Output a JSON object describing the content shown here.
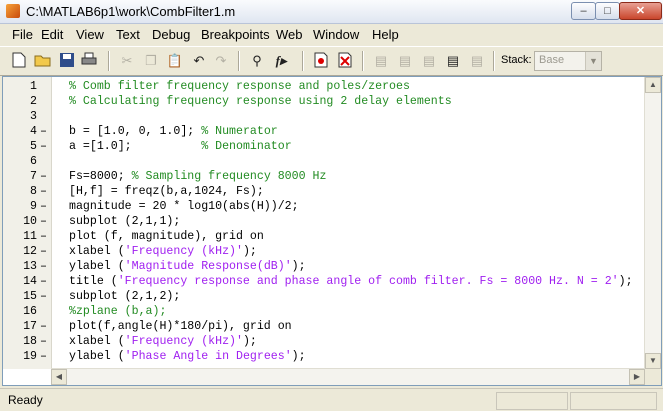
{
  "window": {
    "title": "C:\\MATLAB6p1\\work\\CombFilter1.m"
  },
  "titlebar_buttons": {
    "minimize": "–",
    "maximize": "□",
    "close": "✕"
  },
  "menu": [
    "File",
    "Edit",
    "View",
    "Text",
    "Debug",
    "Breakpoints",
    "Web",
    "Window",
    "Help"
  ],
  "toolbar": {
    "icons": [
      "new-file",
      "open-folder",
      "save",
      "print",
      "cut",
      "copy",
      "paste",
      "undo",
      "redo",
      "find",
      "function",
      "set-breakpoint",
      "clear-breakpoint",
      "step",
      "step-in",
      "step-out",
      "continue",
      "quit-debug"
    ],
    "stack_label": "Stack:",
    "stack_value": "Base"
  },
  "editor": {
    "lines": [
      {
        "n": "1",
        "bp": "",
        "segs": [
          {
            "t": "% Comb filter frequency response and poles/zeroes",
            "c": "comment"
          }
        ]
      },
      {
        "n": "2",
        "bp": "",
        "segs": [
          {
            "t": "% Calculating frequency response using 2 delay elements",
            "c": "comment"
          }
        ]
      },
      {
        "n": "3",
        "bp": "",
        "segs": []
      },
      {
        "n": "4",
        "bp": "–",
        "segs": [
          {
            "t": "b = [1.0, 0, 1.0]; ",
            "c": "plain"
          },
          {
            "t": "% Numerator",
            "c": "comment"
          }
        ]
      },
      {
        "n": "5",
        "bp": "–",
        "segs": [
          {
            "t": "a =[1.0];          ",
            "c": "plain"
          },
          {
            "t": "% Denominator",
            "c": "comment"
          }
        ]
      },
      {
        "n": "6",
        "bp": "",
        "segs": []
      },
      {
        "n": "7",
        "bp": "–",
        "segs": [
          {
            "t": "Fs=8000; ",
            "c": "plain"
          },
          {
            "t": "% Sampling frequency 8000 Hz",
            "c": "comment"
          }
        ]
      },
      {
        "n": "8",
        "bp": "–",
        "segs": [
          {
            "t": "[H,f] = freqz(b,a,1024, Fs);",
            "c": "plain"
          }
        ]
      },
      {
        "n": "9",
        "bp": "–",
        "segs": [
          {
            "t": "magnitude = 20 * log10(abs(H))/2;",
            "c": "plain"
          }
        ]
      },
      {
        "n": "10",
        "bp": "–",
        "segs": [
          {
            "t": "subplot (2,1,1);",
            "c": "plain"
          }
        ]
      },
      {
        "n": "11",
        "bp": "–",
        "segs": [
          {
            "t": "plot (f, magnitude), grid on",
            "c": "plain"
          }
        ]
      },
      {
        "n": "12",
        "bp": "–",
        "segs": [
          {
            "t": "xlabel (",
            "c": "plain"
          },
          {
            "t": "'Frequency (kHz)'",
            "c": "string"
          },
          {
            "t": ");",
            "c": "plain"
          }
        ]
      },
      {
        "n": "13",
        "bp": "–",
        "segs": [
          {
            "t": "ylabel (",
            "c": "plain"
          },
          {
            "t": "'Magnitude Response(dB)'",
            "c": "string"
          },
          {
            "t": ");",
            "c": "plain"
          }
        ]
      },
      {
        "n": "14",
        "bp": "–",
        "segs": [
          {
            "t": "title (",
            "c": "plain"
          },
          {
            "t": "'Frequency response and phase angle of comb filter. Fs = 8000 Hz. N = 2'",
            "c": "string"
          },
          {
            "t": ");",
            "c": "plain"
          }
        ]
      },
      {
        "n": "15",
        "bp": "–",
        "segs": [
          {
            "t": "subplot (2,1,2);",
            "c": "plain"
          }
        ]
      },
      {
        "n": "16",
        "bp": "",
        "segs": [
          {
            "t": "%zplane (b,a);",
            "c": "comment"
          }
        ]
      },
      {
        "n": "17",
        "bp": "–",
        "segs": [
          {
            "t": "plot(f,angle(H)*180/pi), grid on",
            "c": "plain"
          }
        ]
      },
      {
        "n": "18",
        "bp": "–",
        "segs": [
          {
            "t": "xlabel (",
            "c": "plain"
          },
          {
            "t": "'Frequency (kHz)'",
            "c": "string"
          },
          {
            "t": ");",
            "c": "plain"
          }
        ]
      },
      {
        "n": "19",
        "bp": "–",
        "segs": [
          {
            "t": "ylabel (",
            "c": "plain"
          },
          {
            "t": "'Phase Angle in Degrees'",
            "c": "string"
          },
          {
            "t": ");",
            "c": "plain"
          }
        ]
      }
    ]
  },
  "status": {
    "text": "Ready"
  },
  "colors": {
    "comment": "#228b22",
    "string": "#a020f0",
    "plain": "#000000"
  }
}
